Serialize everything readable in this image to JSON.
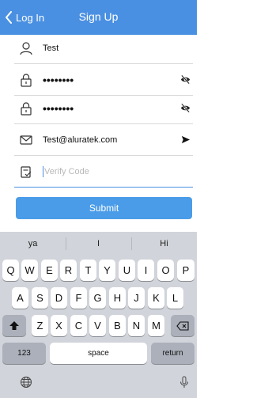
{
  "nav": {
    "back_label": "Log In",
    "title": "Sign Up"
  },
  "form": {
    "username": {
      "value": "Test",
      "icon": "user-icon"
    },
    "password": {
      "value": "••••••••",
      "icon": "lock-icon",
      "toggle_icon": "eye-slash-icon"
    },
    "confirm_password": {
      "value": "••••••••",
      "icon": "lock-icon",
      "toggle_icon": "eye-slash-icon"
    },
    "email": {
      "value": "Test@aluratek.com",
      "icon": "mail-icon",
      "action_icon": "send-arrow-icon"
    },
    "verify_code": {
      "placeholder": "Verify Code",
      "icon": "verify-code-icon"
    },
    "submit_label": "Submit"
  },
  "keyboard": {
    "suggestions": [
      "ya",
      "I",
      "Hi"
    ],
    "row1": [
      "Q",
      "W",
      "E",
      "R",
      "T",
      "Y",
      "U",
      "I",
      "O",
      "P"
    ],
    "row2": [
      "A",
      "S",
      "D",
      "F",
      "G",
      "H",
      "J",
      "K",
      "L"
    ],
    "row3": [
      "Z",
      "X",
      "C",
      "V",
      "B",
      "N",
      "M"
    ],
    "numbers_label": "123",
    "space_label": "space",
    "return_label": "return",
    "icons": {
      "shift": "shift-icon",
      "delete": "backspace-icon",
      "globe": "globe-icon",
      "mic": "microphone-icon"
    }
  },
  "colors": {
    "accent": "#4a90e2",
    "button": "#4a9ce8",
    "keyboard_bg": "#d1d4da"
  }
}
